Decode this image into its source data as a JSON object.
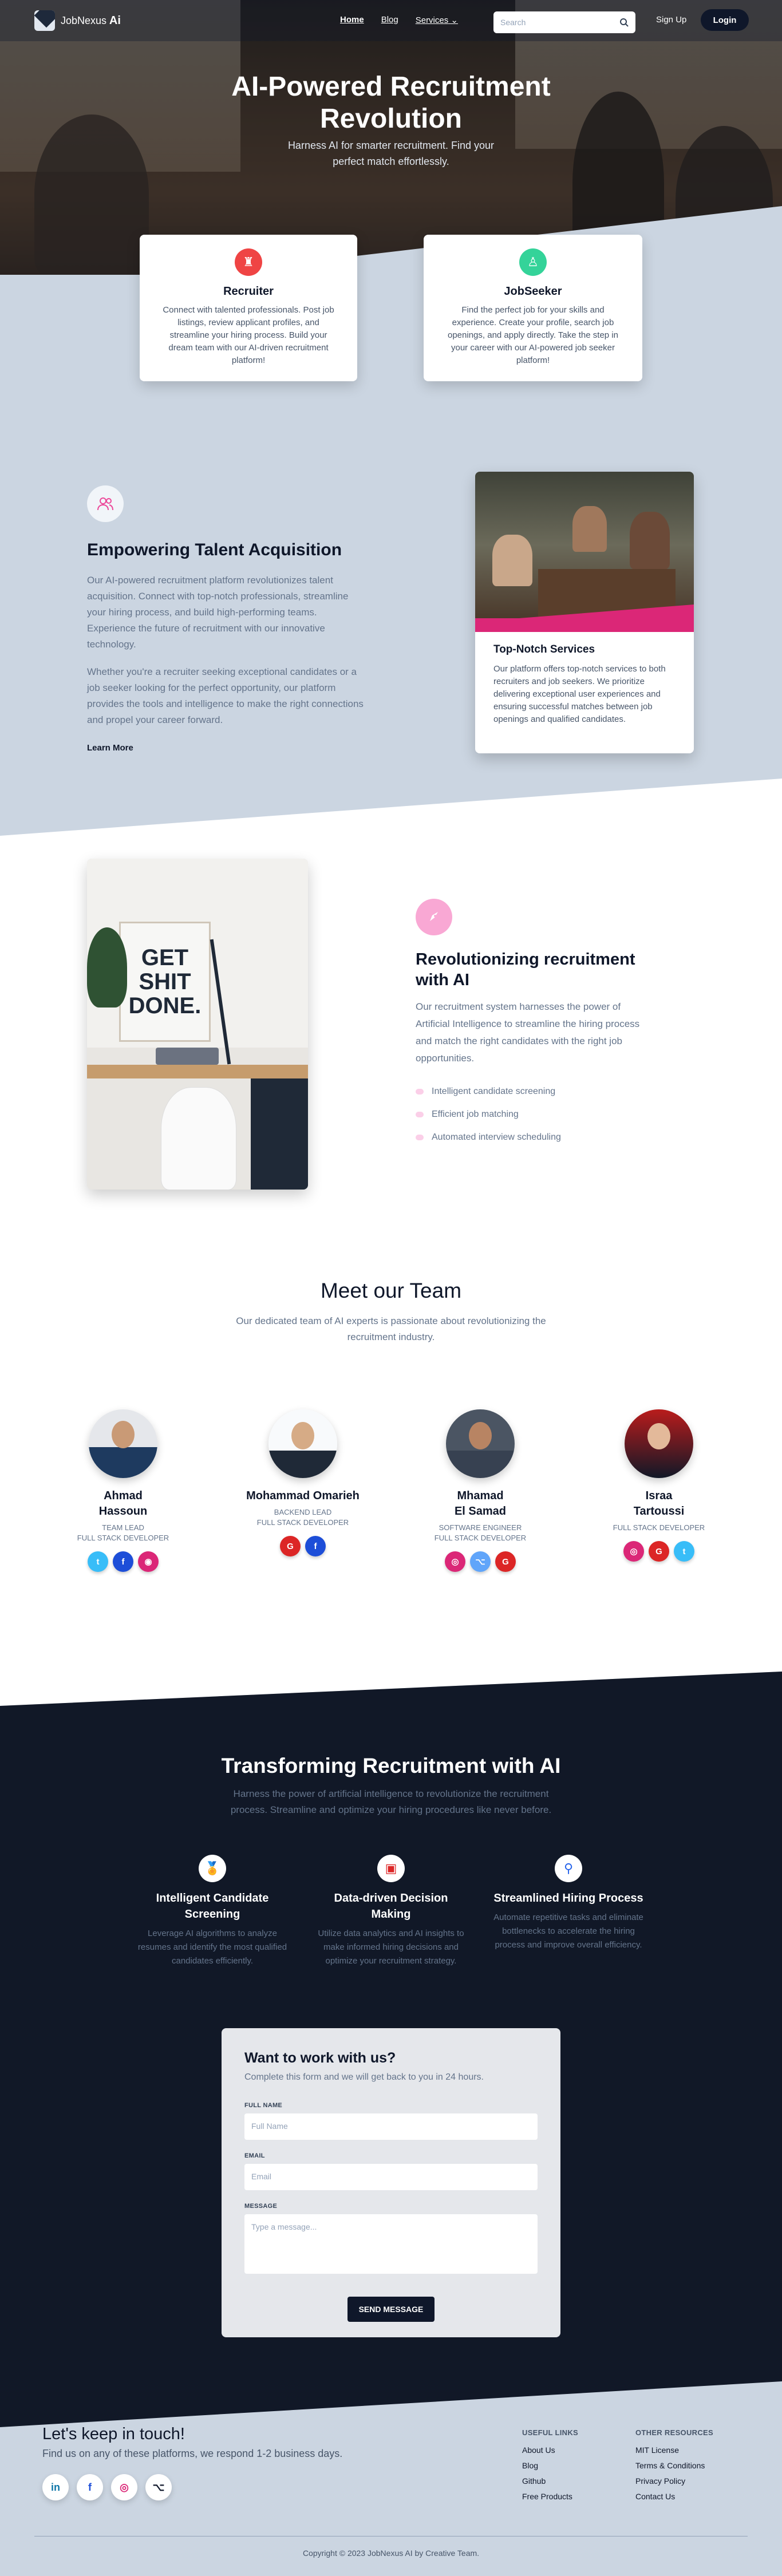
{
  "nav": {
    "brand_prefix": "JobNexus",
    "brand_suffix": "Ai",
    "links": [
      "Home",
      "Blog",
      "Services"
    ],
    "search_placeholder": "Search",
    "signup": "Sign Up",
    "login": "Login"
  },
  "hero": {
    "title": "AI-Powered Recruitment Revolution",
    "subtitle": "Harness AI for smarter recruitment. Find your perfect match effortlessly."
  },
  "cards": {
    "recruiter": {
      "title": "Recruiter",
      "text": "Connect with talented professionals. Post job listings, review applicant profiles, and streamline your hiring process. Build your dream team with our AI-driven recruitment platform!"
    },
    "jobseeker": {
      "title": "JobSeeker",
      "text": "Find the perfect job for your skills and experience. Create your profile, search job openings, and apply directly. Take the step in your career with our AI-powered job seeker platform!"
    }
  },
  "empower": {
    "title": "Empowering Talent Acquisition",
    "p1": "Our AI-powered recruitment platform revolutionizes talent acquisition. Connect with top-notch professionals, streamline your hiring process, and build high-performing teams. Experience the future of recruitment with our innovative technology.",
    "p2": "Whether you're a recruiter seeking exceptional candidates or a job seeker looking for the perfect opportunity, our platform provides the tools and intelligence to make the right connections and propel your career forward.",
    "learn_more": "Learn More",
    "card_title": "Top-Notch Services",
    "card_text": "Our platform offers top-notch services to both recruiters and job seekers. We prioritize delivering exceptional user experiences and ensuring successful matches between job openings and qualified candidates."
  },
  "revolution": {
    "poster": "GET SHIT DONE.",
    "title": "Revolutionizing recruitment with AI",
    "text": "Our recruitment system harnesses the power of Artificial Intelligence to streamline the hiring process and match the right candidates with the right job opportunities.",
    "features": [
      "Intelligent candidate screening",
      "Efficient job matching",
      "Automated interview scheduling"
    ]
  },
  "team": {
    "title": "Meet our Team",
    "subtitle": "Our dedicated team of AI experts is passionate about revolutionizing the recruitment industry.",
    "members": [
      {
        "name1": "Ahmad",
        "name2": "Hassoun",
        "role1": "TEAM LEAD",
        "role2": "FULL STACK DEVELOPER"
      },
      {
        "name1": "Mohammad Omarieh",
        "name2": "",
        "role1": "BACKEND LEAD",
        "role2": "FULL STACK DEVELOPER"
      },
      {
        "name1": "Mhamad",
        "name2": "El Samad",
        "role1": "SOFTWARE ENGINEER",
        "role2": "FULL STACK DEVELOPER"
      },
      {
        "name1": "Israa",
        "name2": "Tartoussi",
        "role1": "",
        "role2": "FULL STACK DEVELOPER"
      }
    ]
  },
  "transform": {
    "title": "Transforming Recruitment with AI",
    "subtitle": "Harness the power of artificial intelligence to revolutionize the recruitment process. Streamline and optimize your hiring procedures like never before.",
    "features": [
      {
        "title": "Intelligent Candidate Screening",
        "text": "Leverage AI algorithms to analyze resumes and identify the most qualified candidates efficiently."
      },
      {
        "title": "Data-driven Decision Making",
        "text": "Utilize data analytics and AI insights to make informed hiring decisions and optimize your recruitment strategy."
      },
      {
        "title": "Streamlined Hiring Process",
        "text": "Automate repetitive tasks and eliminate bottlenecks to accelerate the hiring process and improve overall efficiency."
      }
    ]
  },
  "contact": {
    "title": "Want to work with us?",
    "subtitle": "Complete this form and we will get back to you in 24 hours.",
    "name_label": "FULL NAME",
    "name_placeholder": "Full Name",
    "email_label": "EMAIL",
    "email_placeholder": "Email",
    "message_label": "MESSAGE",
    "message_placeholder": "Type a message...",
    "send": "SEND MESSAGE"
  },
  "footer": {
    "title": "Let's keep in touch!",
    "subtitle": "Find us on any of these platforms, we respond 1-2 business days.",
    "useful_title": "USEFUL LINKS",
    "useful": [
      "About Us",
      "Blog",
      "Github",
      "Free Products"
    ],
    "other_title": "OTHER RESOURCES",
    "other": [
      "MIT License",
      "Terms & Conditions",
      "Privacy Policy",
      "Contact Us"
    ],
    "copyright": "Copyright © 2023 JobNexus AI by Creative Team."
  },
  "colors": {
    "accent_pink": "#db2777",
    "navy": "#0f172a",
    "recruiter_icon": "#ef4444",
    "jobseeker_icon": "#34d399"
  }
}
